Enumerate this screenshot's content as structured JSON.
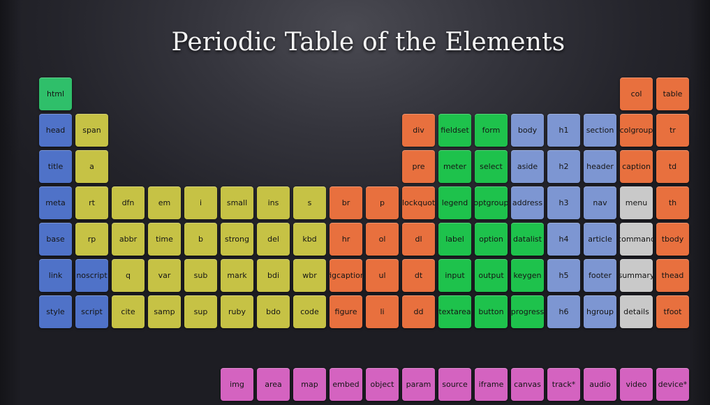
{
  "title": "Periodic Table of the Elements",
  "colors": {
    "root": "#2fbf6a",
    "metadata": "#4f72c8",
    "text": "#c6c245",
    "grouping": "#e8703e",
    "forms": "#1ec24c",
    "sections": "#7d96d2",
    "interactive": "#c9c9c9",
    "embedded": "#d463c0"
  },
  "elements": [
    {
      "label": "html",
      "cat": "root",
      "row": 0,
      "col": 0
    },
    {
      "label": "col",
      "cat": "group",
      "row": 0,
      "col": 16
    },
    {
      "label": "table",
      "cat": "group",
      "row": 0,
      "col": 17
    },
    {
      "label": "head",
      "cat": "meta",
      "row": 1,
      "col": 0
    },
    {
      "label": "span",
      "cat": "text",
      "row": 1,
      "col": 1
    },
    {
      "label": "div",
      "cat": "group",
      "row": 1,
      "col": 10
    },
    {
      "label": "fieldset",
      "cat": "form",
      "row": 1,
      "col": 11
    },
    {
      "label": "form",
      "cat": "form",
      "row": 1,
      "col": 12
    },
    {
      "label": "body",
      "cat": "sect",
      "row": 1,
      "col": 13
    },
    {
      "label": "h1",
      "cat": "sect",
      "row": 1,
      "col": 14
    },
    {
      "label": "section",
      "cat": "sect",
      "row": 1,
      "col": 15
    },
    {
      "label": "colgroup",
      "cat": "group",
      "row": 1,
      "col": 16
    },
    {
      "label": "tr",
      "cat": "group",
      "row": 1,
      "col": 17
    },
    {
      "label": "title",
      "cat": "meta",
      "row": 2,
      "col": 0
    },
    {
      "label": "a",
      "cat": "text",
      "row": 2,
      "col": 1
    },
    {
      "label": "pre",
      "cat": "group",
      "row": 2,
      "col": 10
    },
    {
      "label": "meter",
      "cat": "form",
      "row": 2,
      "col": 11
    },
    {
      "label": "select",
      "cat": "form",
      "row": 2,
      "col": 12
    },
    {
      "label": "aside",
      "cat": "sect",
      "row": 2,
      "col": 13
    },
    {
      "label": "h2",
      "cat": "sect",
      "row": 2,
      "col": 14
    },
    {
      "label": "header",
      "cat": "sect",
      "row": 2,
      "col": 15
    },
    {
      "label": "caption",
      "cat": "group",
      "row": 2,
      "col": 16
    },
    {
      "label": "td",
      "cat": "group",
      "row": 2,
      "col": 17
    },
    {
      "label": "meta",
      "cat": "meta",
      "row": 3,
      "col": 0
    },
    {
      "label": "rt",
      "cat": "text",
      "row": 3,
      "col": 1
    },
    {
      "label": "dfn",
      "cat": "text",
      "row": 3,
      "col": 2
    },
    {
      "label": "em",
      "cat": "text",
      "row": 3,
      "col": 3
    },
    {
      "label": "i",
      "cat": "text",
      "row": 3,
      "col": 4
    },
    {
      "label": "small",
      "cat": "text",
      "row": 3,
      "col": 5
    },
    {
      "label": "ins",
      "cat": "text",
      "row": 3,
      "col": 6
    },
    {
      "label": "s",
      "cat": "text",
      "row": 3,
      "col": 7
    },
    {
      "label": "br",
      "cat": "group",
      "row": 3,
      "col": 8
    },
    {
      "label": "p",
      "cat": "group",
      "row": 3,
      "col": 9
    },
    {
      "label": "blockquote",
      "cat": "group",
      "row": 3,
      "col": 10
    },
    {
      "label": "legend",
      "cat": "form",
      "row": 3,
      "col": 11
    },
    {
      "label": "optgroup",
      "cat": "form",
      "row": 3,
      "col": 12
    },
    {
      "label": "address",
      "cat": "sect",
      "row": 3,
      "col": 13
    },
    {
      "label": "h3",
      "cat": "sect",
      "row": 3,
      "col": 14
    },
    {
      "label": "nav",
      "cat": "sect",
      "row": 3,
      "col": 15
    },
    {
      "label": "menu",
      "cat": "inter",
      "row": 3,
      "col": 16
    },
    {
      "label": "th",
      "cat": "group",
      "row": 3,
      "col": 17
    },
    {
      "label": "base",
      "cat": "meta",
      "row": 4,
      "col": 0
    },
    {
      "label": "rp",
      "cat": "text",
      "row": 4,
      "col": 1
    },
    {
      "label": "abbr",
      "cat": "text",
      "row": 4,
      "col": 2
    },
    {
      "label": "time",
      "cat": "text",
      "row": 4,
      "col": 3
    },
    {
      "label": "b",
      "cat": "text",
      "row": 4,
      "col": 4
    },
    {
      "label": "strong",
      "cat": "text",
      "row": 4,
      "col": 5
    },
    {
      "label": "del",
      "cat": "text",
      "row": 4,
      "col": 6
    },
    {
      "label": "kbd",
      "cat": "text",
      "row": 4,
      "col": 7
    },
    {
      "label": "hr",
      "cat": "group",
      "row": 4,
      "col": 8
    },
    {
      "label": "ol",
      "cat": "group",
      "row": 4,
      "col": 9
    },
    {
      "label": "dl",
      "cat": "group",
      "row": 4,
      "col": 10
    },
    {
      "label": "label",
      "cat": "form",
      "row": 4,
      "col": 11
    },
    {
      "label": "option",
      "cat": "form",
      "row": 4,
      "col": 12
    },
    {
      "label": "datalist",
      "cat": "form",
      "row": 4,
      "col": 13
    },
    {
      "label": "h4",
      "cat": "sect",
      "row": 4,
      "col": 14
    },
    {
      "label": "article",
      "cat": "sect",
      "row": 4,
      "col": 15
    },
    {
      "label": "command",
      "cat": "inter",
      "row": 4,
      "col": 16
    },
    {
      "label": "tbody",
      "cat": "group",
      "row": 4,
      "col": 17
    },
    {
      "label": "link",
      "cat": "meta",
      "row": 5,
      "col": 0
    },
    {
      "label": "noscript",
      "cat": "meta",
      "row": 5,
      "col": 1
    },
    {
      "label": "q",
      "cat": "text",
      "row": 5,
      "col": 2
    },
    {
      "label": "var",
      "cat": "text",
      "row": 5,
      "col": 3
    },
    {
      "label": "sub",
      "cat": "text",
      "row": 5,
      "col": 4
    },
    {
      "label": "mark",
      "cat": "text",
      "row": 5,
      "col": 5
    },
    {
      "label": "bdi",
      "cat": "text",
      "row": 5,
      "col": 6
    },
    {
      "label": "wbr",
      "cat": "text",
      "row": 5,
      "col": 7
    },
    {
      "label": "figcaption",
      "cat": "group",
      "row": 5,
      "col": 8
    },
    {
      "label": "ul",
      "cat": "group",
      "row": 5,
      "col": 9
    },
    {
      "label": "dt",
      "cat": "group",
      "row": 5,
      "col": 10
    },
    {
      "label": "input",
      "cat": "form",
      "row": 5,
      "col": 11
    },
    {
      "label": "output",
      "cat": "form",
      "row": 5,
      "col": 12
    },
    {
      "label": "keygen",
      "cat": "form",
      "row": 5,
      "col": 13
    },
    {
      "label": "h5",
      "cat": "sect",
      "row": 5,
      "col": 14
    },
    {
      "label": "footer",
      "cat": "sect",
      "row": 5,
      "col": 15
    },
    {
      "label": "summary",
      "cat": "inter",
      "row": 5,
      "col": 16
    },
    {
      "label": "thead",
      "cat": "group",
      "row": 5,
      "col": 17
    },
    {
      "label": "style",
      "cat": "meta",
      "row": 6,
      "col": 0
    },
    {
      "label": "script",
      "cat": "meta",
      "row": 6,
      "col": 1
    },
    {
      "label": "cite",
      "cat": "text",
      "row": 6,
      "col": 2
    },
    {
      "label": "samp",
      "cat": "text",
      "row": 6,
      "col": 3
    },
    {
      "label": "sup",
      "cat": "text",
      "row": 6,
      "col": 4
    },
    {
      "label": "ruby",
      "cat": "text",
      "row": 6,
      "col": 5
    },
    {
      "label": "bdo",
      "cat": "text",
      "row": 6,
      "col": 6
    },
    {
      "label": "code",
      "cat": "text",
      "row": 6,
      "col": 7
    },
    {
      "label": "figure",
      "cat": "group",
      "row": 6,
      "col": 8
    },
    {
      "label": "li",
      "cat": "group",
      "row": 6,
      "col": 9
    },
    {
      "label": "dd",
      "cat": "group",
      "row": 6,
      "col": 10
    },
    {
      "label": "textarea",
      "cat": "form",
      "row": 6,
      "col": 11
    },
    {
      "label": "button",
      "cat": "form",
      "row": 6,
      "col": 12
    },
    {
      "label": "progress",
      "cat": "form",
      "row": 6,
      "col": 13
    },
    {
      "label": "h6",
      "cat": "sect",
      "row": 6,
      "col": 14
    },
    {
      "label": "hgroup",
      "cat": "sect",
      "row": 6,
      "col": 15
    },
    {
      "label": "details",
      "cat": "inter",
      "row": 6,
      "col": 16
    },
    {
      "label": "tfoot",
      "cat": "group",
      "row": 6,
      "col": 17
    },
    {
      "label": "img",
      "cat": "embed",
      "row": 8,
      "col": 5
    },
    {
      "label": "area",
      "cat": "embed",
      "row": 8,
      "col": 6
    },
    {
      "label": "map",
      "cat": "embed",
      "row": 8,
      "col": 7
    },
    {
      "label": "embed",
      "cat": "embed",
      "row": 8,
      "col": 8
    },
    {
      "label": "object",
      "cat": "embed",
      "row": 8,
      "col": 9
    },
    {
      "label": "param",
      "cat": "embed",
      "row": 8,
      "col": 10
    },
    {
      "label": "source",
      "cat": "embed",
      "row": 8,
      "col": 11
    },
    {
      "label": "iframe",
      "cat": "embed",
      "row": 8,
      "col": 12
    },
    {
      "label": "canvas",
      "cat": "embed",
      "row": 8,
      "col": 13
    },
    {
      "label": "track*",
      "cat": "embed",
      "row": 8,
      "col": 14
    },
    {
      "label": "audio",
      "cat": "embed",
      "row": 8,
      "col": 15
    },
    {
      "label": "video",
      "cat": "embed",
      "row": 8,
      "col": 16
    },
    {
      "label": "device*",
      "cat": "embed",
      "row": 8,
      "col": 17
    }
  ]
}
